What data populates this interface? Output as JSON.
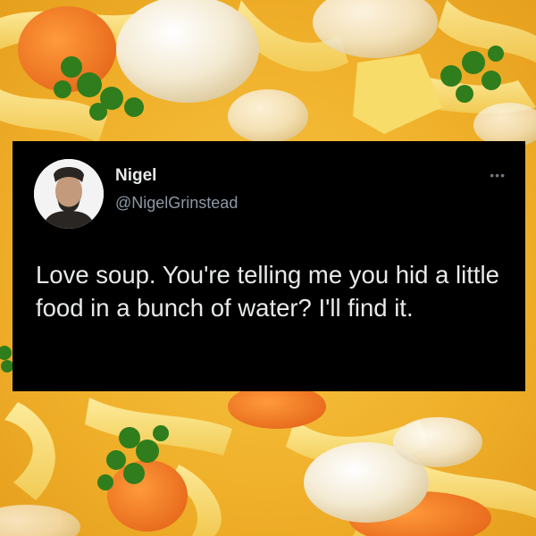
{
  "tweet": {
    "name": "Nigel",
    "handle": "@NigelGrinstead",
    "text": "Love soup. You're telling me you hid a little food in a bunch of water? I'll find it."
  },
  "icons": {
    "more": "more-horizontal-icon",
    "avatar": "profile-photo"
  },
  "colors": {
    "card_background": "#000000",
    "name_text": "#e7e9ea",
    "handle_text": "#8b98a5",
    "soup_broth": "#f2b531"
  }
}
